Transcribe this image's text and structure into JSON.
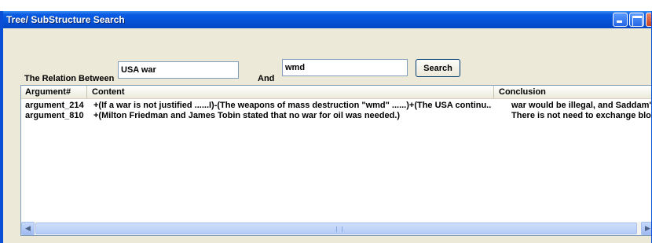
{
  "window": {
    "title": "Tree/ SubStructure Search"
  },
  "search": {
    "relation_label": "The Relation Between",
    "term1_value": "USA war",
    "and_label": "And",
    "term2_value": "wmd",
    "search_button": "Search"
  },
  "results": {
    "columns": [
      "Argument#",
      "Content",
      "Conclusion"
    ],
    "rows": [
      {
        "argument": "argument_214",
        "content": "+(If a war is not justified ......I)-(The weapons of mass destruction \"wmd\" ......)+(The USA continu...",
        "conclusion": "war would be illegal, and Saddam's ..."
      },
      {
        "argument": "argument_810",
        "content": "+(Milton Friedman and James Tobin stated that no war for oil was needed.)",
        "conclusion": "There is not need to exchange blood"
      }
    ]
  },
  "icons": {
    "scroll_left": "chevron-left-icon",
    "scroll_right": "chevron-right-icon",
    "minimize": "minimize-icon",
    "maximize": "maximize-icon",
    "close": "close-icon"
  },
  "colors": {
    "titlebar": "#0552d6",
    "window_bg": "#ece9d8",
    "border": "#7f9db9"
  }
}
